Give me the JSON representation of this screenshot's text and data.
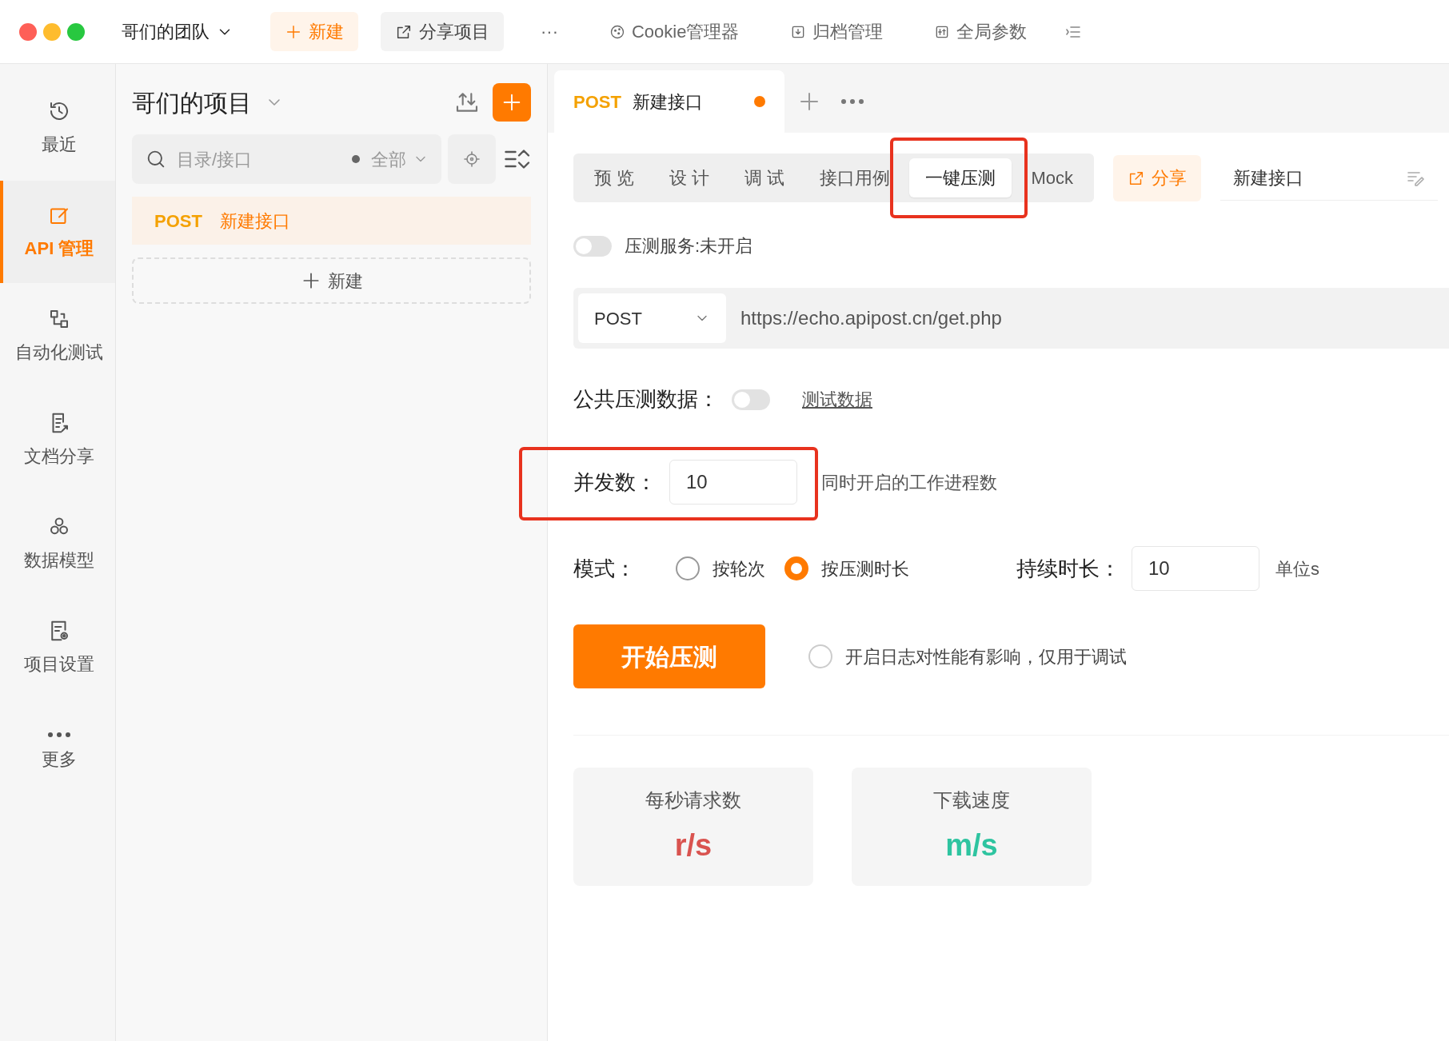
{
  "window": {
    "team": "哥们的团队"
  },
  "toolbar": [
    {
      "kind": "primary",
      "label": "新建"
    },
    {
      "kind": "secondary",
      "label": "分享项目"
    },
    {
      "kind": "plain",
      "label": "···"
    },
    {
      "kind": "link",
      "label": "Cookie管理器"
    },
    {
      "kind": "link",
      "label": "归档管理"
    },
    {
      "kind": "link",
      "label": "全局参数"
    },
    {
      "kind": "icon"
    }
  ],
  "sidebar": {
    "items": [
      {
        "label": "最近",
        "selected": false
      },
      {
        "label": "API 管理",
        "selected": true
      },
      {
        "label": "自动化测试",
        "selected": false
      },
      {
        "label": "文档分享",
        "selected": false
      },
      {
        "label": "数据模型",
        "selected": false
      },
      {
        "label": "项目设置",
        "selected": false
      },
      {
        "label": "更多",
        "selected": false
      }
    ]
  },
  "project": {
    "title": "哥们的项目",
    "search": {
      "placeholder": "目录/接口"
    },
    "filter": "全部",
    "items": [
      {
        "method": "POST",
        "name": "新建接口",
        "selected": true
      }
    ],
    "new_button": "新建"
  },
  "tabs": [
    {
      "method": "POST",
      "label": "新建接口",
      "unsaved": true,
      "selected": true
    }
  ],
  "sub_tabs": [
    {
      "label": "预 览",
      "selected": false,
      "highlighted": false
    },
    {
      "label": "设 计",
      "selected": false,
      "highlighted": false
    },
    {
      "label": "调 试",
      "selected": false,
      "highlighted": false
    },
    {
      "label": "接口用例",
      "selected": false,
      "highlighted": false
    },
    {
      "label": "一键压测",
      "selected": true,
      "highlighted": true
    },
    {
      "label": "Mock",
      "selected": false,
      "highlighted": false
    }
  ],
  "share_button": "分享",
  "name_field": {
    "value": "新建接口"
  },
  "service": {
    "on": false,
    "label": "压测服务:未开启"
  },
  "request": {
    "method": "POST",
    "url": "https://echo.apipost.cn/get.php"
  },
  "public_data": {
    "label": "公共压测数据：",
    "on": false,
    "link": "测试数据"
  },
  "concurrency": {
    "label": "并发数：",
    "value": "10",
    "hint": "同时开启的工作进程数",
    "highlighted": true
  },
  "mode": {
    "label": "模式：",
    "options": [
      {
        "label": "按轮次",
        "selected": false
      },
      {
        "label": "按压测时长",
        "selected": true
      }
    ]
  },
  "duration": {
    "label": "持续时长：",
    "value": "10",
    "unit": "单位s"
  },
  "start_button": "开始压测",
  "log": {
    "checked": false,
    "label": "开启日志对性能有影响，仅用于调试"
  },
  "stats": [
    {
      "title": "每秒请求数",
      "unit": "r/s",
      "color": "#d9534f"
    },
    {
      "title": "下载速度",
      "unit": "m/s",
      "color": "#2ec4a0"
    }
  ]
}
